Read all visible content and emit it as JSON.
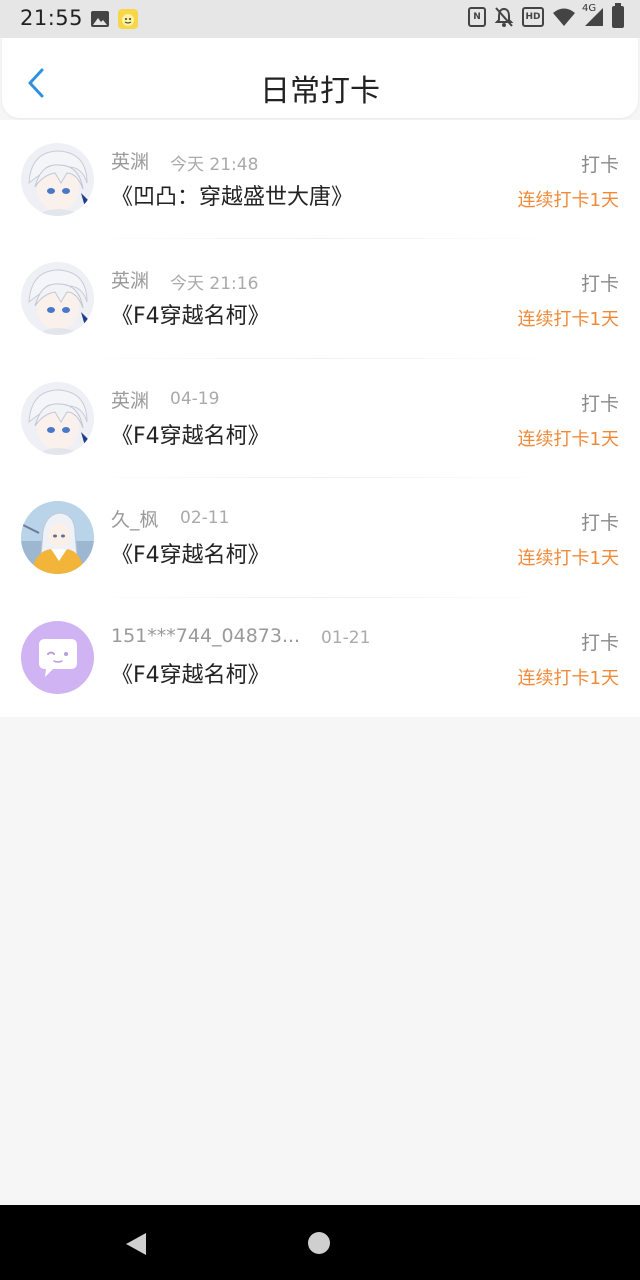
{
  "status_bar": {
    "time": "21:55",
    "network": "4G",
    "icons": [
      "image-icon",
      "app-notification-icon",
      "nfc-icon",
      "bell-off-icon",
      "hd-icon",
      "wifi-icon",
      "signal-icon",
      "battery-icon"
    ]
  },
  "header": {
    "title": "日常打卡",
    "back_icon": "chevron-left-icon",
    "accent_color": "#2f8fe0"
  },
  "list": [
    {
      "name": "英渊",
      "time": "今天 21:48",
      "book": "《凹凸：穿越盛世大唐》",
      "action": "打卡",
      "streak": "连续打卡1天",
      "avatar": "anime-white-hair"
    },
    {
      "name": "英渊",
      "time": "今天 21:16",
      "book": "《F4穿越名柯》",
      "action": "打卡",
      "streak": "连续打卡1天",
      "avatar": "anime-white-hair"
    },
    {
      "name": "英渊",
      "time": "04-19",
      "book": "《F4穿越名柯》",
      "action": "打卡",
      "streak": "连续打卡1天",
      "avatar": "anime-white-hair"
    },
    {
      "name": "久_枫",
      "time": "02-11",
      "book": "《F4穿越名柯》",
      "action": "打卡",
      "streak": "连续打卡1天",
      "avatar": "anime-yellow-coat"
    },
    {
      "name": "151***744_04873...",
      "time": "01-21",
      "book": "《F4穿越名柯》",
      "action": "打卡",
      "streak": "连续打卡1天",
      "avatar": "default-chat-bubble"
    }
  ],
  "colors": {
    "streak": "#f08a3a",
    "meta_gray": "#9a9a9a",
    "default_avatar_bg": "#cfb3f3"
  },
  "nav_bar": {
    "icons": [
      "nav-back-icon",
      "nav-home-icon"
    ]
  }
}
